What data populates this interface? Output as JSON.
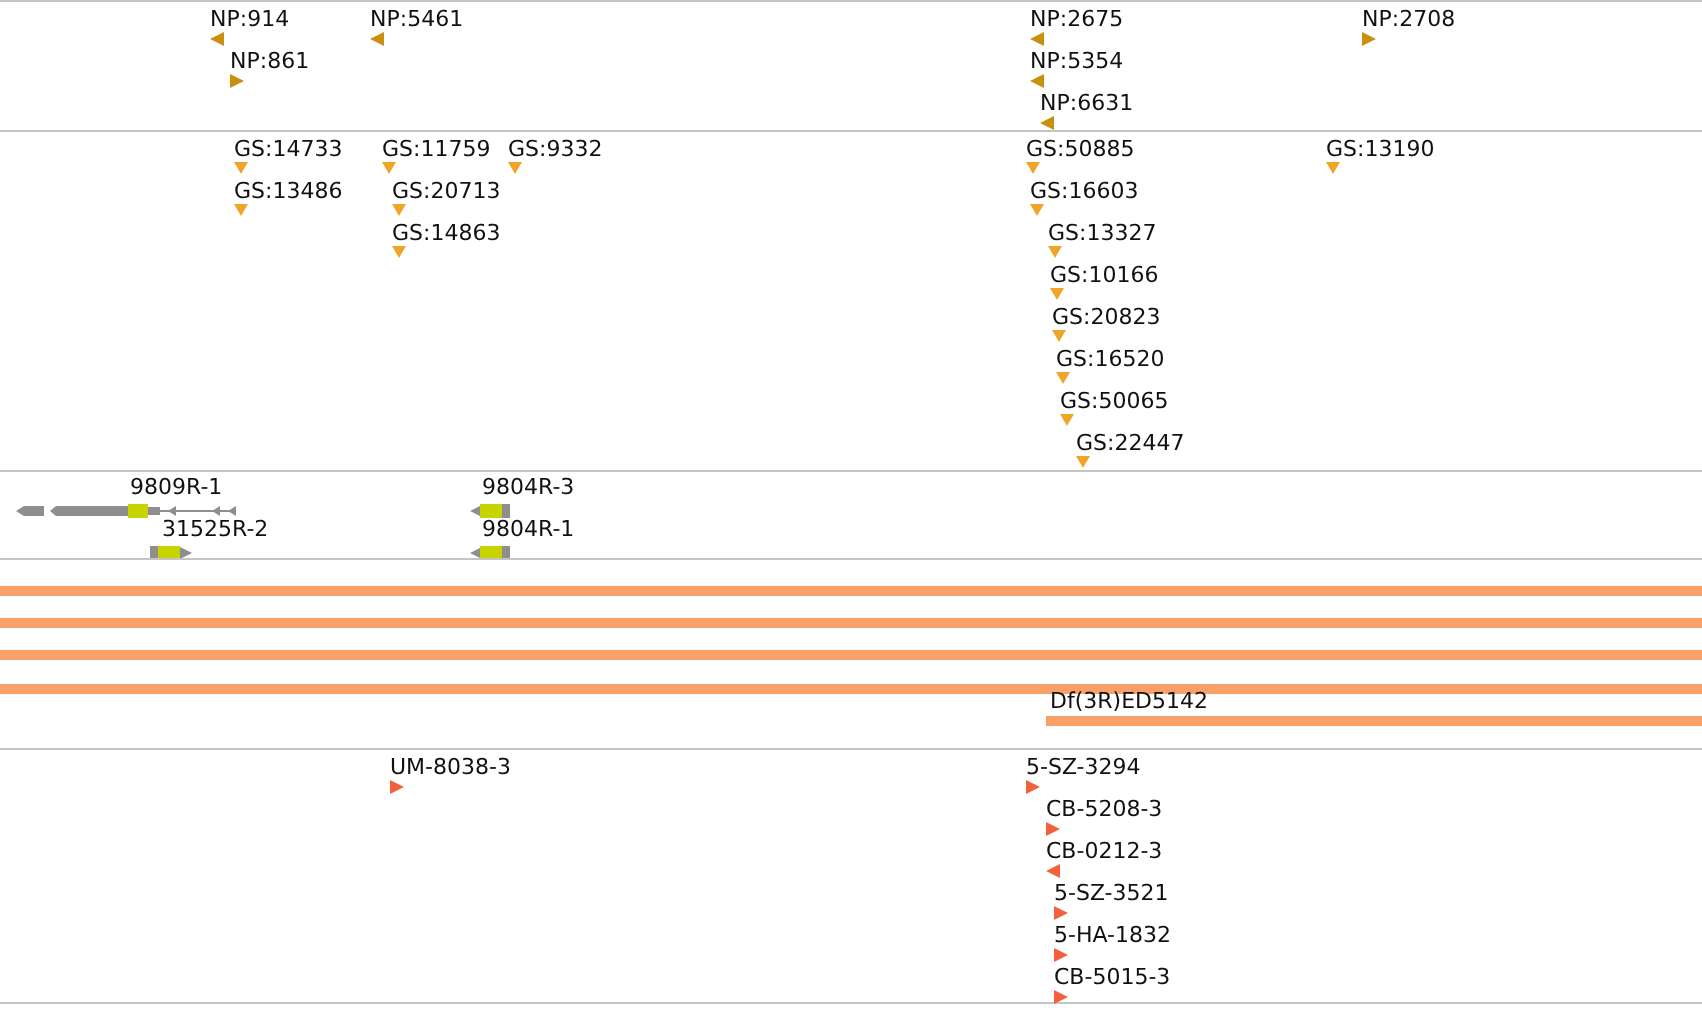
{
  "tracks": [
    {
      "kind": "feature",
      "items": [
        {
          "label": "NP:914",
          "reverse": true
        },
        {
          "label": "NP:861",
          "reverse": false
        },
        {
          "label": "NP:5461",
          "reverse": true
        },
        {
          "label": "NP:2675",
          "reverse": true
        },
        {
          "label": "NP:5354",
          "reverse": true
        },
        {
          "label": "NP:6631",
          "reverse": true
        },
        {
          "label": "NP:2708",
          "reverse": false
        }
      ]
    },
    {
      "kind": "site",
      "items": [
        {
          "label": "GS:14733"
        },
        {
          "label": "GS:13486"
        },
        {
          "label": "GS:11759"
        },
        {
          "label": "GS:9332"
        },
        {
          "label": "GS:20713"
        },
        {
          "label": "GS:14863"
        },
        {
          "label": "GS:50885"
        },
        {
          "label": "GS:16603"
        },
        {
          "label": "GS:13327"
        },
        {
          "label": "GS:10166"
        },
        {
          "label": "GS:20823"
        },
        {
          "label": "GS:16520"
        },
        {
          "label": "GS:50065"
        },
        {
          "label": "GS:22447"
        },
        {
          "label": "GS:13190"
        }
      ]
    },
    {
      "kind": "gene",
      "items": [
        {
          "label": "9809R-1",
          "reverse": true
        },
        {
          "label": "31525R-2",
          "reverse": false
        },
        {
          "label": "9804R-3",
          "reverse": true
        },
        {
          "label": "9804R-1",
          "reverse": true
        }
      ]
    },
    {
      "kind": "range",
      "items": [
        {
          "full": true
        },
        {
          "full": true
        },
        {
          "full": true
        },
        {
          "full": true
        },
        {
          "full": false,
          "label": "Df(3R)ED5142"
        }
      ]
    },
    {
      "kind": "insertion",
      "items": [
        {
          "label": "UM-8038-3",
          "reverse": false
        },
        {
          "label": "5-SZ-3294",
          "reverse": false
        },
        {
          "label": "CB-5208-3",
          "reverse": false
        },
        {
          "label": "CB-0212-3",
          "reverse": true
        },
        {
          "label": "5-SZ-3521",
          "reverse": false
        },
        {
          "label": "5-HA-1832",
          "reverse": false
        },
        {
          "label": "CB-5015-3",
          "reverse": false
        }
      ]
    }
  ]
}
